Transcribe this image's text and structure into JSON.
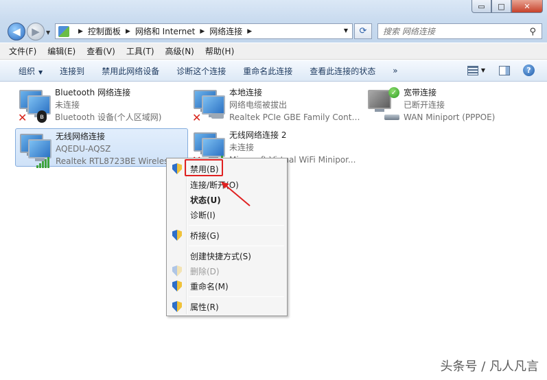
{
  "window": {
    "controls": {
      "minimize": "▭",
      "maximize": "□",
      "close": "✕"
    }
  },
  "address": {
    "crumbs": [
      "控制面板",
      "网络和 Internet",
      "网络连接"
    ],
    "search_placeholder": "搜索 网络连接"
  },
  "menubar": [
    "文件(F)",
    "编辑(E)",
    "查看(V)",
    "工具(T)",
    "高级(N)",
    "帮助(H)"
  ],
  "cmdbar": {
    "organize": "组织",
    "items": [
      "连接到",
      "禁用此网络设备",
      "诊断这个连接",
      "重命名此连接",
      "查看此连接的状态"
    ],
    "more": "»",
    "help": "?"
  },
  "connections": [
    {
      "name": "Bluetooth 网络连接",
      "status": "未连接",
      "device": "Bluetooth 设备(个人区域网)"
    },
    {
      "name": "本地连接",
      "status": "网络电缆被拔出",
      "device": "Realtek PCIe GBE Family Contr..."
    },
    {
      "name": "宽带连接",
      "status": "已断开连接",
      "device": "WAN Miniport (PPPOE)"
    },
    {
      "name": "无线网络连接",
      "status": "AQEDU-AQSZ",
      "device": "Realtek RTL8723BE Wireless L..."
    },
    {
      "name": "无线网络连接 2",
      "status": "未连接",
      "device": "Microsoft Virtual WiFi Minipor..."
    }
  ],
  "context_menu": {
    "disable": "禁用(B)",
    "connect": "连接/断开(O)",
    "status": "状态(U)",
    "diagnose": "诊断(I)",
    "bridge": "桥接(G)",
    "shortcut": "创建快捷方式(S)",
    "delete": "删除(D)",
    "rename": "重命名(M)",
    "properties": "属性(R)"
  },
  "watermark": "头条号 / 凡人凡言",
  "colors": {
    "highlight": "#e02020",
    "selection": "#cfe2f8"
  }
}
